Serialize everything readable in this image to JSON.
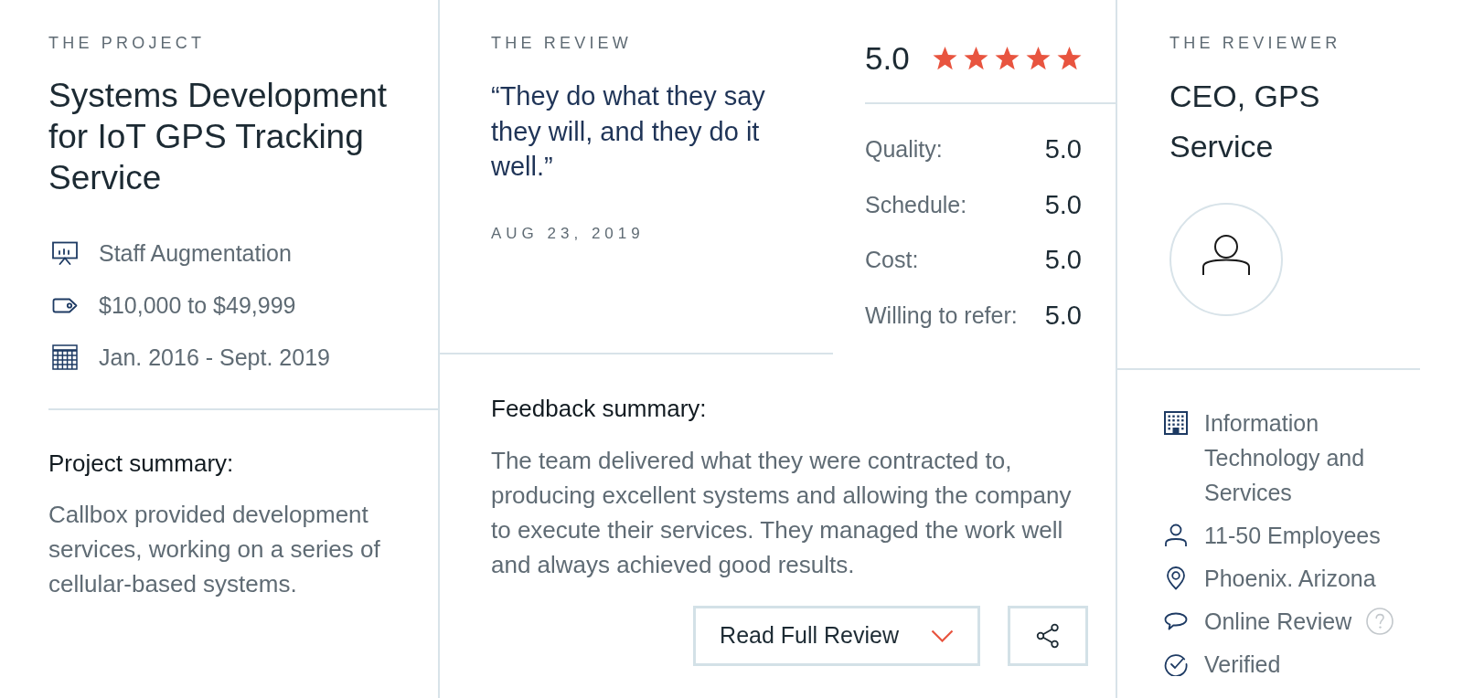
{
  "project": {
    "heading": "THE PROJECT",
    "title": "Systems Development for IoT GPS Tracking Service",
    "details": [
      {
        "kind": "service",
        "text": "Staff Augmentation"
      },
      {
        "kind": "budget",
        "text": "$10,000 to $49,999"
      },
      {
        "kind": "dates",
        "text": "Jan. 2016 - Sept. 2019"
      }
    ],
    "summary": {
      "heading": "Project summary:",
      "text": "Callbox provided development services, working on a series of cellular-based systems."
    }
  },
  "review": {
    "heading": "THE REVIEW",
    "quote": "“They do what they say they will, and they do it well.”",
    "date": "AUG 23, 2019",
    "overall": {
      "score": "5.0",
      "stars": 5
    },
    "ratings": [
      {
        "label": "Quality:",
        "value": "5.0"
      },
      {
        "label": "Schedule:",
        "value": "5.0"
      },
      {
        "label": "Cost:",
        "value": "5.0"
      },
      {
        "label": "Willing to refer:",
        "value": "5.0"
      }
    ],
    "feedback": {
      "heading": "Feedback summary:",
      "text": "The team delivered what they were contracted to, producing excellent systems and allowing the company to execute their services. They managed the work well and always achieved good results."
    },
    "actions": {
      "read_more": "Read Full Review"
    }
  },
  "reviewer": {
    "heading": "THE REVIEWER",
    "name": "CEO, GPS Service",
    "details": [
      {
        "kind": "industry",
        "text": "Information Technology and Services",
        "help": false
      },
      {
        "kind": "size",
        "text": "11-50 Employees",
        "help": false
      },
      {
        "kind": "location",
        "text": "Phoenix. Arizona",
        "help": false
      },
      {
        "kind": "review_type",
        "text": "Online Review",
        "help": true
      },
      {
        "kind": "verification",
        "text": "Verified",
        "help": false
      }
    ]
  }
}
